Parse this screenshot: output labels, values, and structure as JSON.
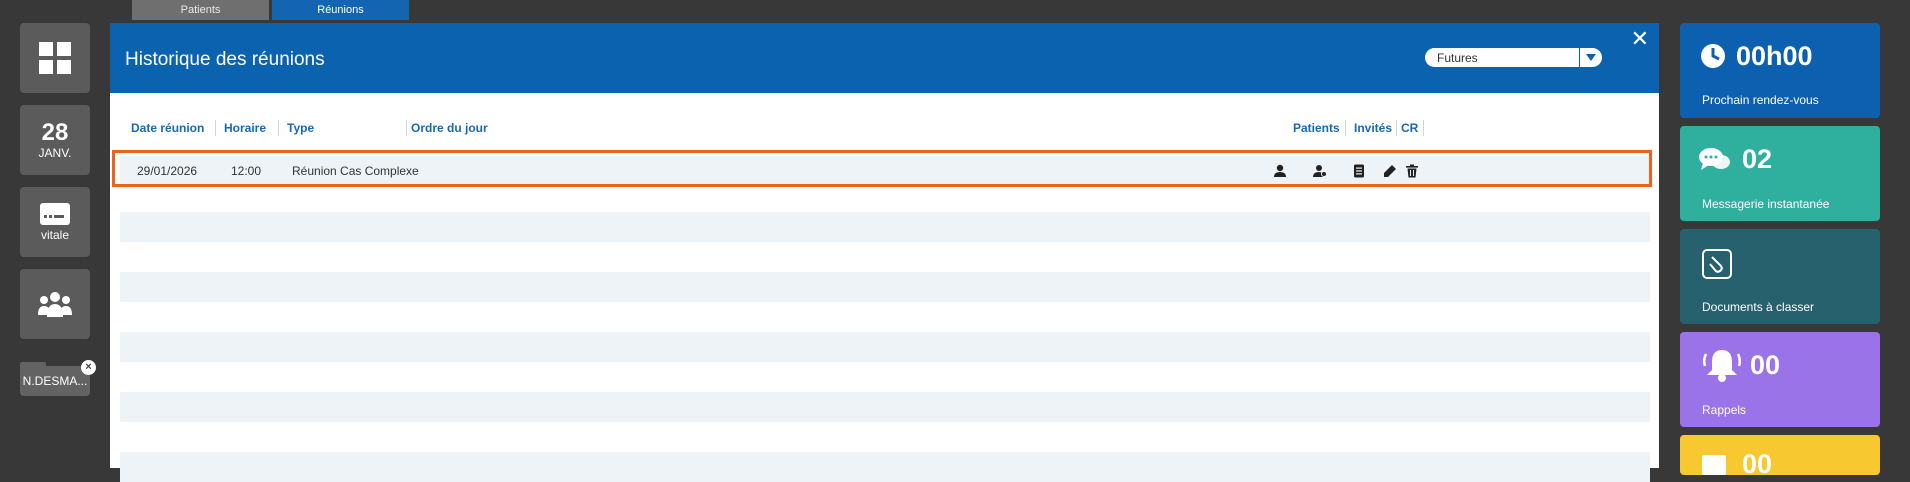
{
  "top_tabs": {
    "patients": "Patients",
    "reunions": "Réunions"
  },
  "left_rail": {
    "date_day": "28",
    "date_month": "JANV.",
    "vitale_label": "vitale",
    "folder_label": "N.DESMA..."
  },
  "modal": {
    "title": "Historique des réunions",
    "filter_value": "Futures",
    "columns": {
      "date": "Date réunion",
      "horaire": "Horaire",
      "type": "Type",
      "ordre": "Ordre du jour",
      "patients": "Patients",
      "invites": "Invités",
      "cr": "CR"
    },
    "rows": [
      {
        "date": "29/01/2026",
        "horaire": "12:00",
        "type": "Réunion Cas Complexe",
        "ordre": ""
      }
    ]
  },
  "tiles": {
    "rdv": {
      "value": "00h00",
      "label": "Prochain rendez-vous",
      "color": "#0d5fb0"
    },
    "messagerie": {
      "value": "02",
      "label": "Messagerie instantanée",
      "color": "#2fb09e"
    },
    "documents": {
      "label": "Documents à classer",
      "color": "#27616d"
    },
    "rappels": {
      "value": "00",
      "label": "Rappels",
      "color": "#9b73e8"
    },
    "last": {
      "value": "00",
      "color": "#f7c82f"
    }
  },
  "colors": {
    "accent": "#0b63b0",
    "highlight": "#f0621c"
  }
}
